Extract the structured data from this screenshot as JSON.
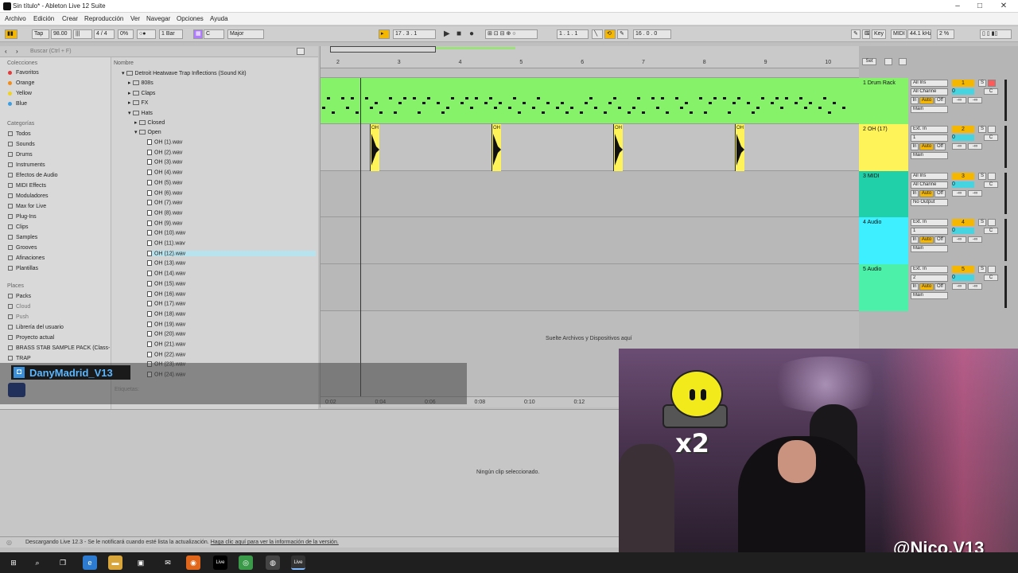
{
  "window": {
    "title": "Sin título* - Ableton Live 12 Suite"
  },
  "menu": [
    "Archivo",
    "Edición",
    "Crear",
    "Reproducción",
    "Ver",
    "Navegar",
    "Opciones",
    "Ayuda"
  ],
  "control_bar": {
    "tap": "Tap",
    "tempo": "98.00",
    "signature": "4 / 4",
    "groove": "0%",
    "quantize": "1 Bar",
    "key": "C",
    "scale": "Major",
    "position": "17 . 3 . 1",
    "loop_start": "1 . 1 . 1",
    "loop_length": "16 . 0 . 0",
    "key_label": "Key",
    "midi_label": "MIDI",
    "sample_rate": "44.1 kHz",
    "cpu": "2 %"
  },
  "browser": {
    "search_placeholder": "Buscar (Ctrl + F)",
    "collections_header": "Colecciones",
    "collections": [
      {
        "label": "Favoritos",
        "color": "#e23b3b"
      },
      {
        "label": "Orange",
        "color": "#f28c18"
      },
      {
        "label": "Yellow",
        "color": "#f2d21a"
      },
      {
        "label": "Blue",
        "color": "#3b9fe2"
      }
    ],
    "categories_header": "Categorías",
    "categories": [
      "Todos",
      "Sounds",
      "Drums",
      "Instruments",
      "Efectos de Audio",
      "MIDI Effects",
      "Moduladores",
      "Max for Live",
      "Plug-Ins",
      "Clips",
      "Samples",
      "Grooves",
      "Afinaciones",
      "Plantillas"
    ],
    "places_header": "Places",
    "places": [
      "Packs",
      "Cloud",
      "Push",
      "Librería del usuario",
      "Proyecto actual",
      "BRASS STAB SAMPLE PACK (Class-",
      "TRAP"
    ],
    "column_header": "Nombre",
    "root_folder": "Detroit Heatwave Trap Inflections (Sound Kit)",
    "folders": [
      "808s",
      "Claps",
      "FX",
      "Hats"
    ],
    "subfolders": [
      "Closed",
      "Open"
    ],
    "files": [
      "OH (1).wav",
      "OH (2).wav",
      "OH (3).wav",
      "OH (4).wav",
      "OH (5).wav",
      "OH (6).wav",
      "OH (7).wav",
      "OH (8).wav",
      "OH (9).wav",
      "OH (10).wav",
      "OH (11).wav",
      "OH (12).wav",
      "OH (13).wav",
      "OH (14).wav",
      "OH (15).wav",
      "OH (16).wav",
      "OH (17).wav",
      "OH (18).wav",
      "OH (19).wav",
      "OH (20).wav",
      "OH (21).wav",
      "OH (22).wav",
      "OH (23).wav",
      "OH (24).wav"
    ],
    "selected_file": "OH (12).wav",
    "tags_label": "Etiquetas:"
  },
  "arrangement": {
    "bar_numbers": [
      "2",
      "3",
      "4",
      "5",
      "6",
      "7",
      "8",
      "9",
      "10"
    ],
    "time_labels": [
      "0:02",
      "0:04",
      "0:06",
      "0:08",
      "0:10",
      "0:12"
    ],
    "clip_label": "OH",
    "drop_hint": "Suelte Archivos y Dispositivos aquí",
    "set_label": "Set"
  },
  "tracks": [
    {
      "name": "1 Drum Rack",
      "input": "All Ins",
      "channel": "All Channe",
      "monitor": "Auto",
      "output": "Main",
      "number": "1",
      "color": "#85f26a"
    },
    {
      "name": "2 OH (17)",
      "input": "Ext. In",
      "channel": "1",
      "monitor": "Auto",
      "output": "Main",
      "number": "2",
      "color": "#fff35a"
    },
    {
      "name": "3 MIDI",
      "input": "All Ins",
      "channel": "All Channe",
      "monitor": "Auto",
      "output": "No Output",
      "number": "3",
      "color": "#1fd0a8"
    },
    {
      "name": "4 Audio",
      "input": "Ext. In",
      "channel": "1",
      "monitor": "Auto",
      "output": "Main",
      "number": "4",
      "color": "#3ef0ff"
    },
    {
      "name": "5 Audio",
      "input": "Ext. In",
      "channel": "2",
      "monitor": "Auto",
      "output": "Main",
      "number": "5",
      "color": "#4cf0a8"
    }
  ],
  "track_labels": {
    "in": "In",
    "off": "Off",
    "solo": "S",
    "center": "C",
    "volume": "0",
    "send": "-∞"
  },
  "detail": {
    "empty_label": "Ningún clip seleccionado."
  },
  "status": {
    "message": "Descargando Live 12.3 - Se le notificará cuando esté lista la actualización.",
    "link": "Haga clic aquí para ver la información de la versión."
  },
  "overlay": {
    "streamer_name": "DanyMadrid_V13",
    "emote_text": "x2",
    "handle": "@Nico.V13"
  },
  "colors": {
    "accent": "#f5b700",
    "selection": "#b6e3ee",
    "taskbar": "#1f1f1f"
  }
}
